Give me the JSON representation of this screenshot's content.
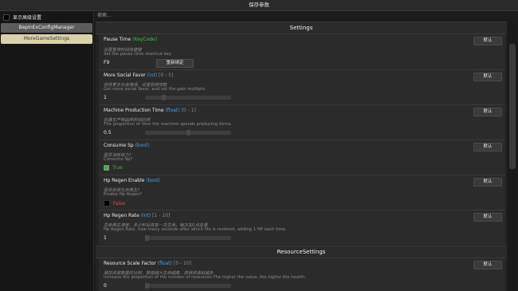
{
  "window": {
    "title": "保存参数"
  },
  "left": {
    "advanced_label": "显示高级设置",
    "plugins": [
      "BepInExConfigManager",
      "MoreGameSettings"
    ]
  },
  "search": {
    "placeholder": "搜索..."
  },
  "sections": {
    "settings": "Settings",
    "resource": "ResourceSettings"
  },
  "default_label": "默认",
  "settings": [
    {
      "name": "Pause Time",
      "type": "(KeyCode)",
      "desc_cn": "设置暂停时间快捷键",
      "desc_en": "Set the pause time shortcut key",
      "value": "F9",
      "rebind_label": "重新绑定"
    },
    {
      "name": "More Social Favor",
      "type": "(int)",
      "range": "[0 - 5]",
      "desc_cn": "获得更多社会情感，设置获得倍数",
      "desc_en": "Get more social favor, and set the gain multiple.",
      "value": "1",
      "level": 0.2
    },
    {
      "name": "Machine Production Time",
      "type": "(float)",
      "range": "[0 - 1]",
      "desc_cn": "机器生产物品所的间比例",
      "desc_en": "The proportion of time the machine spends producing items.",
      "value": "0.5",
      "level": 0.5
    },
    {
      "name": "Consume Sp",
      "type": "(bool)",
      "desc_cn": "是否消耗体力?",
      "desc_en": "Consume Sp?",
      "toggle_label": "True",
      "toggle_color": "#5fa15f",
      "checked": true
    },
    {
      "name": "Hp Regen Enable",
      "type": "(bool)",
      "desc_cn": "是否启用生命再生?",
      "desc_en": "Enable Hp Regen?",
      "toggle_label": "False",
      "toggle_color": "#e04a4a",
      "checked": false
    },
    {
      "name": "Hp Regen Rate",
      "type": "(int)",
      "range": "[1 - 10]",
      "desc_cn": "生命再生速度，多少秒后恢复一次生命，每次加1点血量",
      "desc_en": "Hp Regen Rate, how many seconds after which life is restored, adding 1 HP each time.",
      "value": "1",
      "level": 0.0
    },
    {
      "name": "Resource Scale Factor",
      "type": "(float)",
      "range": "[0 - 10]",
      "desc_cn": "增加资源数量的比例，数值越大生命越高，获得资源就越多",
      "desc_en": "Increase the proportion of the number of resources.The higher the value, the higher the health.",
      "value": "0",
      "level": 0.0
    }
  ]
}
